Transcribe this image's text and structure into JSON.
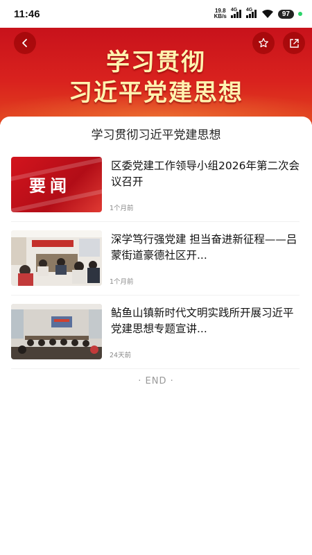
{
  "status_bar": {
    "time": "11:46",
    "net_speed_value": "19.8",
    "net_speed_unit": "KB/s",
    "signal1_label": "4G",
    "signal2_label": "4G",
    "battery": "97",
    "icons": [
      "signal-icon",
      "wifi-icon",
      "battery-icon"
    ]
  },
  "banner": {
    "line1": "学习贯彻",
    "line2": "习近平党建思想",
    "icons": [
      "back-icon",
      "star-icon",
      "share-icon"
    ]
  },
  "section": {
    "title": "学习贯彻习近平党建思想"
  },
  "articles": [
    {
      "title": "区委党建工作领导小组2026年第二次会议召开",
      "time": "1个月前",
      "thumb_text": "要闻"
    },
    {
      "title": "深学笃行强党建 担当奋进新征程——吕蒙街道豪德社区开...",
      "time": "1个月前"
    },
    {
      "title": "鲇鱼山镇新时代文明实践所开展习近平党建思想专题宣讲...",
      "time": "24天前"
    }
  ],
  "footer": {
    "end_text": "· END ·"
  },
  "colors": {
    "banner_red": "#d01a1f",
    "banner_text": "#fff3b0"
  }
}
